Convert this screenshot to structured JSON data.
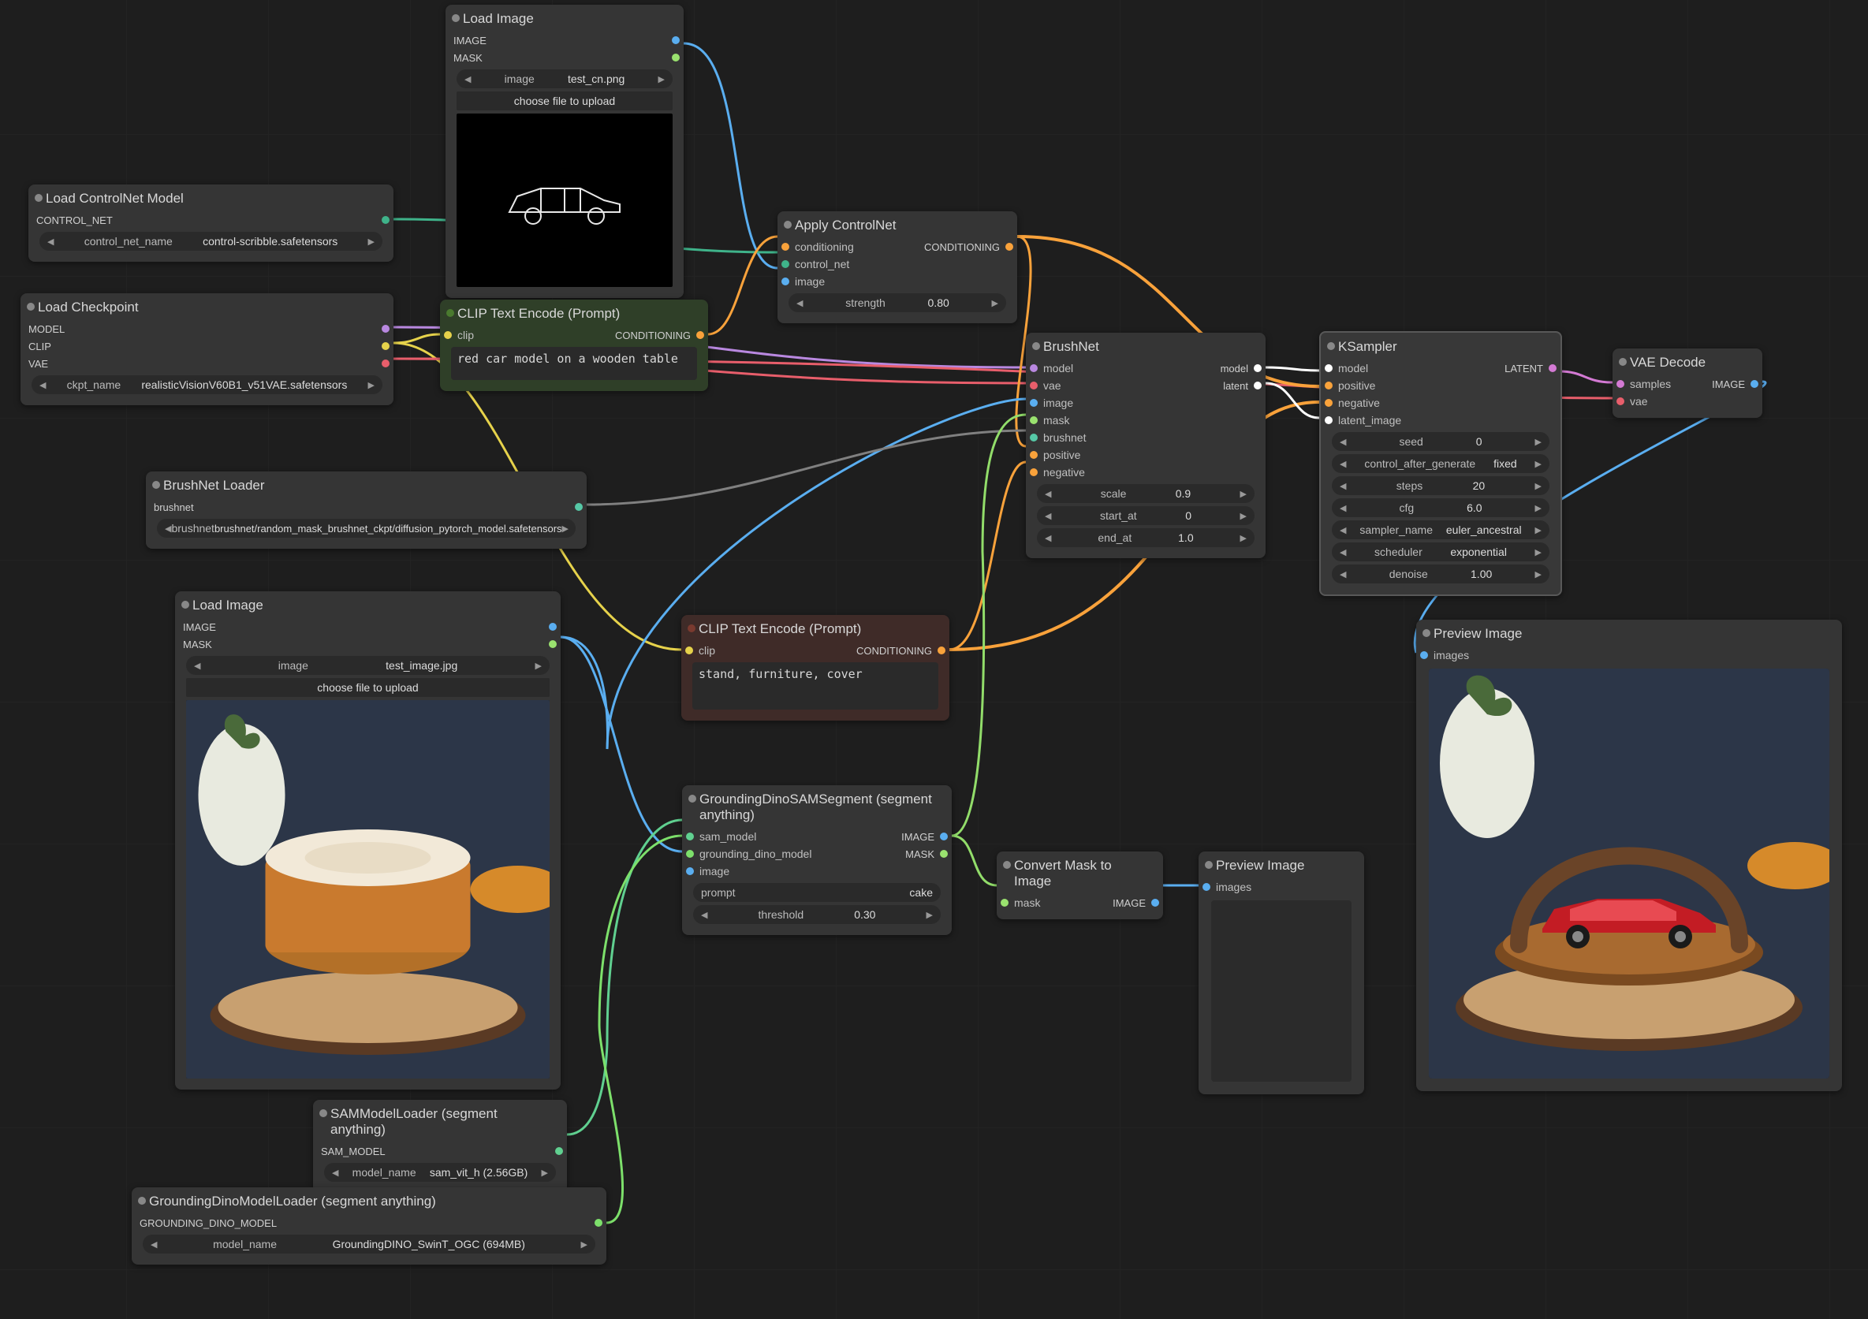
{
  "nodes": {
    "load_image_1": {
      "title": "Load Image",
      "outputs": {
        "image": "IMAGE",
        "mask": "MASK"
      },
      "widgets": {
        "image_label": "image",
        "image_value": "test_cn.png",
        "upload": "choose file to upload"
      }
    },
    "load_controlnet": {
      "title": "Load ControlNet Model",
      "outputs": {
        "control_net": "CONTROL_NET"
      },
      "widgets": {
        "name_label": "control_net_name",
        "name_value": "control-scribble.safetensors"
      }
    },
    "load_checkpoint": {
      "title": "Load Checkpoint",
      "outputs": {
        "model": "MODEL",
        "clip": "CLIP",
        "vae": "VAE"
      },
      "widgets": {
        "ckpt_label": "ckpt_name",
        "ckpt_value": "realisticVisionV60B1_v51VAE.safetensors"
      }
    },
    "clip_pos": {
      "title": "CLIP Text Encode (Prompt)",
      "inputs": {
        "clip": "clip"
      },
      "outputs": {
        "cond": "CONDITIONING"
      },
      "text": "red car model on a wooden table"
    },
    "apply_cn": {
      "title": "Apply ControlNet",
      "inputs": {
        "conditioning": "conditioning",
        "control_net": "control_net",
        "image": "image"
      },
      "outputs": {
        "cond": "CONDITIONING"
      },
      "widgets": {
        "strength_label": "strength",
        "strength_value": "0.80"
      }
    },
    "brushnet_loader": {
      "title": "BrushNet Loader",
      "outputs": {
        "brushnet": "brushnet"
      },
      "widgets": {
        "brushnet_label": "brushnet",
        "brushnet_value": "brushnet/random_mask_brushnet_ckpt/diffusion_pytorch_model.safetensors"
      }
    },
    "load_image_2": {
      "title": "Load Image",
      "outputs": {
        "image": "IMAGE",
        "mask": "MASK"
      },
      "widgets": {
        "image_label": "image",
        "image_value": "test_image.jpg",
        "upload": "choose file to upload"
      }
    },
    "clip_neg": {
      "title": "CLIP Text Encode (Prompt)",
      "inputs": {
        "clip": "clip"
      },
      "outputs": {
        "cond": "CONDITIONING"
      },
      "text": "stand, furniture, cover"
    },
    "gdino_sam": {
      "title": "GroundingDinoSAMSegment (segment anything)",
      "inputs": {
        "sam_model": "sam_model",
        "gdino": "grounding_dino_model",
        "image": "image"
      },
      "outputs": {
        "image": "IMAGE",
        "mask": "MASK"
      },
      "widgets": {
        "prompt_label": "prompt",
        "prompt_value": "cake",
        "threshold_label": "threshold",
        "threshold_value": "0.30"
      }
    },
    "sam_loader": {
      "title": "SAMModelLoader (segment anything)",
      "outputs": {
        "sam_model": "SAM_MODEL"
      },
      "widgets": {
        "model_label": "model_name",
        "model_value": "sam_vit_h (2.56GB)"
      }
    },
    "gdino_loader": {
      "title": "GroundingDinoModelLoader (segment anything)",
      "outputs": {
        "gdino_model": "GROUNDING_DINO_MODEL"
      },
      "widgets": {
        "model_label": "model_name",
        "model_value": "GroundingDINO_SwinT_OGC (694MB)"
      }
    },
    "mask2img": {
      "title": "Convert Mask to Image",
      "inputs": {
        "mask": "mask"
      },
      "outputs": {
        "image": "IMAGE"
      }
    },
    "preview_mask": {
      "title": "Preview Image",
      "inputs": {
        "images": "images"
      }
    },
    "brushnet": {
      "title": "BrushNet",
      "inputs": {
        "model": "model",
        "vae": "vae",
        "image": "image",
        "mask": "mask",
        "brushnet": "brushnet",
        "positive": "positive",
        "negative": "negative"
      },
      "outputs": {
        "model": "model",
        "latent": "latent"
      },
      "widgets": {
        "scale_label": "scale",
        "scale_value": "0.9",
        "start_label": "start_at",
        "start_value": "0",
        "end_label": "end_at",
        "end_value": "1.0"
      }
    },
    "ksampler": {
      "title": "KSampler",
      "inputs": {
        "model": "model",
        "positive": "positive",
        "negative": "negative",
        "latent_image": "latent_image"
      },
      "outputs": {
        "latent": "LATENT"
      },
      "widgets": {
        "seed_label": "seed",
        "seed_value": "0",
        "cag_label": "control_after_generate",
        "cag_value": "fixed",
        "steps_label": "steps",
        "steps_value": "20",
        "cfg_label": "cfg",
        "cfg_value": "6.0",
        "sampler_label": "sampler_name",
        "sampler_value": "euler_ancestral",
        "scheduler_label": "scheduler",
        "scheduler_value": "exponential",
        "denoise_label": "denoise",
        "denoise_value": "1.00"
      }
    },
    "vae_decode": {
      "title": "VAE Decode",
      "inputs": {
        "samples": "samples",
        "vae": "vae"
      },
      "outputs": {
        "image": "IMAGE"
      }
    },
    "preview_out": {
      "title": "Preview Image",
      "inputs": {
        "images": "images"
      }
    }
  }
}
